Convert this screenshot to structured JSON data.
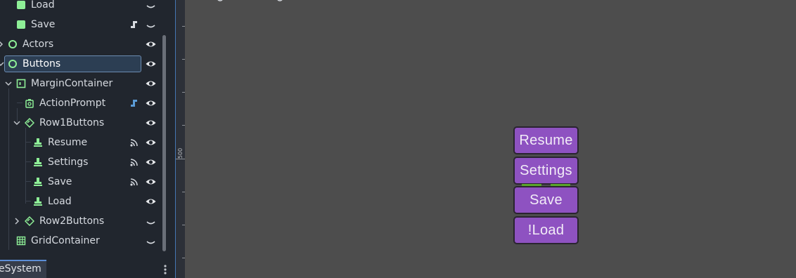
{
  "scene_tree": {
    "nodes": [
      {
        "label": "Load",
        "icon": "control-node-icon",
        "has_script": false,
        "visibility": "hidden-toggle"
      },
      {
        "label": "Save",
        "icon": "control-node-icon",
        "has_script": true,
        "visibility": "hidden-toggle"
      },
      {
        "label": "Actors",
        "icon": "node2d-circle-icon",
        "has_script": false,
        "visibility": "visible"
      },
      {
        "label": "Buttons",
        "icon": "node2d-circle-icon",
        "has_script": false,
        "visibility": "visible",
        "selected": true
      },
      {
        "label": "MarginContainer",
        "icon": "margin-container-icon",
        "has_script": false,
        "visibility": "visible"
      },
      {
        "label": "ActionPrompt",
        "icon": "action-prompt-icon",
        "has_script": true,
        "visibility": "visible"
      },
      {
        "label": "Row1Buttons",
        "icon": "container-icon",
        "has_script": false,
        "visibility": "visible"
      },
      {
        "label": "Resume",
        "icon": "button-node-icon",
        "has_signal": true,
        "visibility": "visible"
      },
      {
        "label": "Settings",
        "icon": "button-node-icon",
        "has_signal": true,
        "visibility": "visible"
      },
      {
        "label": "Save",
        "icon": "button-node-icon",
        "has_signal": true,
        "visibility": "visible"
      },
      {
        "label": "Load",
        "icon": "button-node-icon",
        "has_signal": false,
        "visibility": "visible"
      },
      {
        "label": "Row2Buttons",
        "icon": "container-icon",
        "has_script": false,
        "visibility": "hidden-toggle"
      },
      {
        "label": "GridContainer",
        "icon": "grid-container-icon",
        "has_script": false,
        "visibility": "hidden-toggle"
      }
    ]
  },
  "bottom_tabs": {
    "filesystem_tab": "eSystem"
  },
  "ruler": {
    "label": "500"
  },
  "game_buttons": {
    "resume": "Resume",
    "settings": "Settings",
    "save": "Save",
    "load": "!Load"
  },
  "colors": {
    "panel_bg": "#21262e",
    "viewport_bg": "#4d4d4d",
    "button_purple": "#8e52c1",
    "node_green": "#8eef97",
    "script_blue": "#5b9bd5",
    "selection_border": "#6b8bb1"
  }
}
